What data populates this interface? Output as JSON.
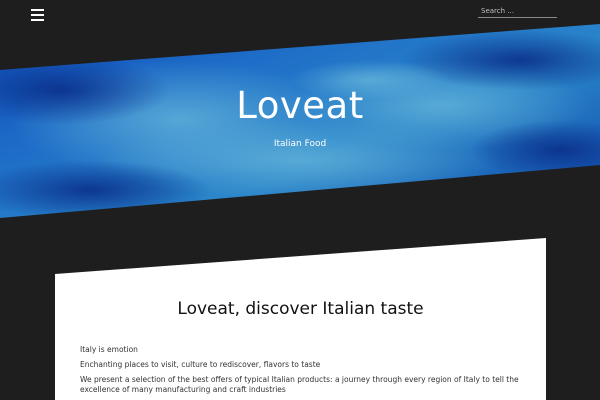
{
  "header": {
    "menu_icon": "hamburger-menu-icon",
    "search_placeholder": "Search ..."
  },
  "hero": {
    "site_title": "Loveat",
    "site_description": "Italian Food"
  },
  "post": {
    "title": "Loveat, discover Italian taste",
    "paragraphs": [
      "Italy is emotion",
      "Enchanting places to visit, culture to rediscover, flavors to taste",
      "We present a selection of the best offers of typical Italian products: a journey through every region of Italy to tell the excellence of many manufacturing and craft industries"
    ]
  },
  "colors": {
    "background": "#1e1e1e",
    "sky_dark": "#0a3a9c",
    "sky_light": "#3b8fd6",
    "card": "#ffffff",
    "text": "#111111"
  }
}
